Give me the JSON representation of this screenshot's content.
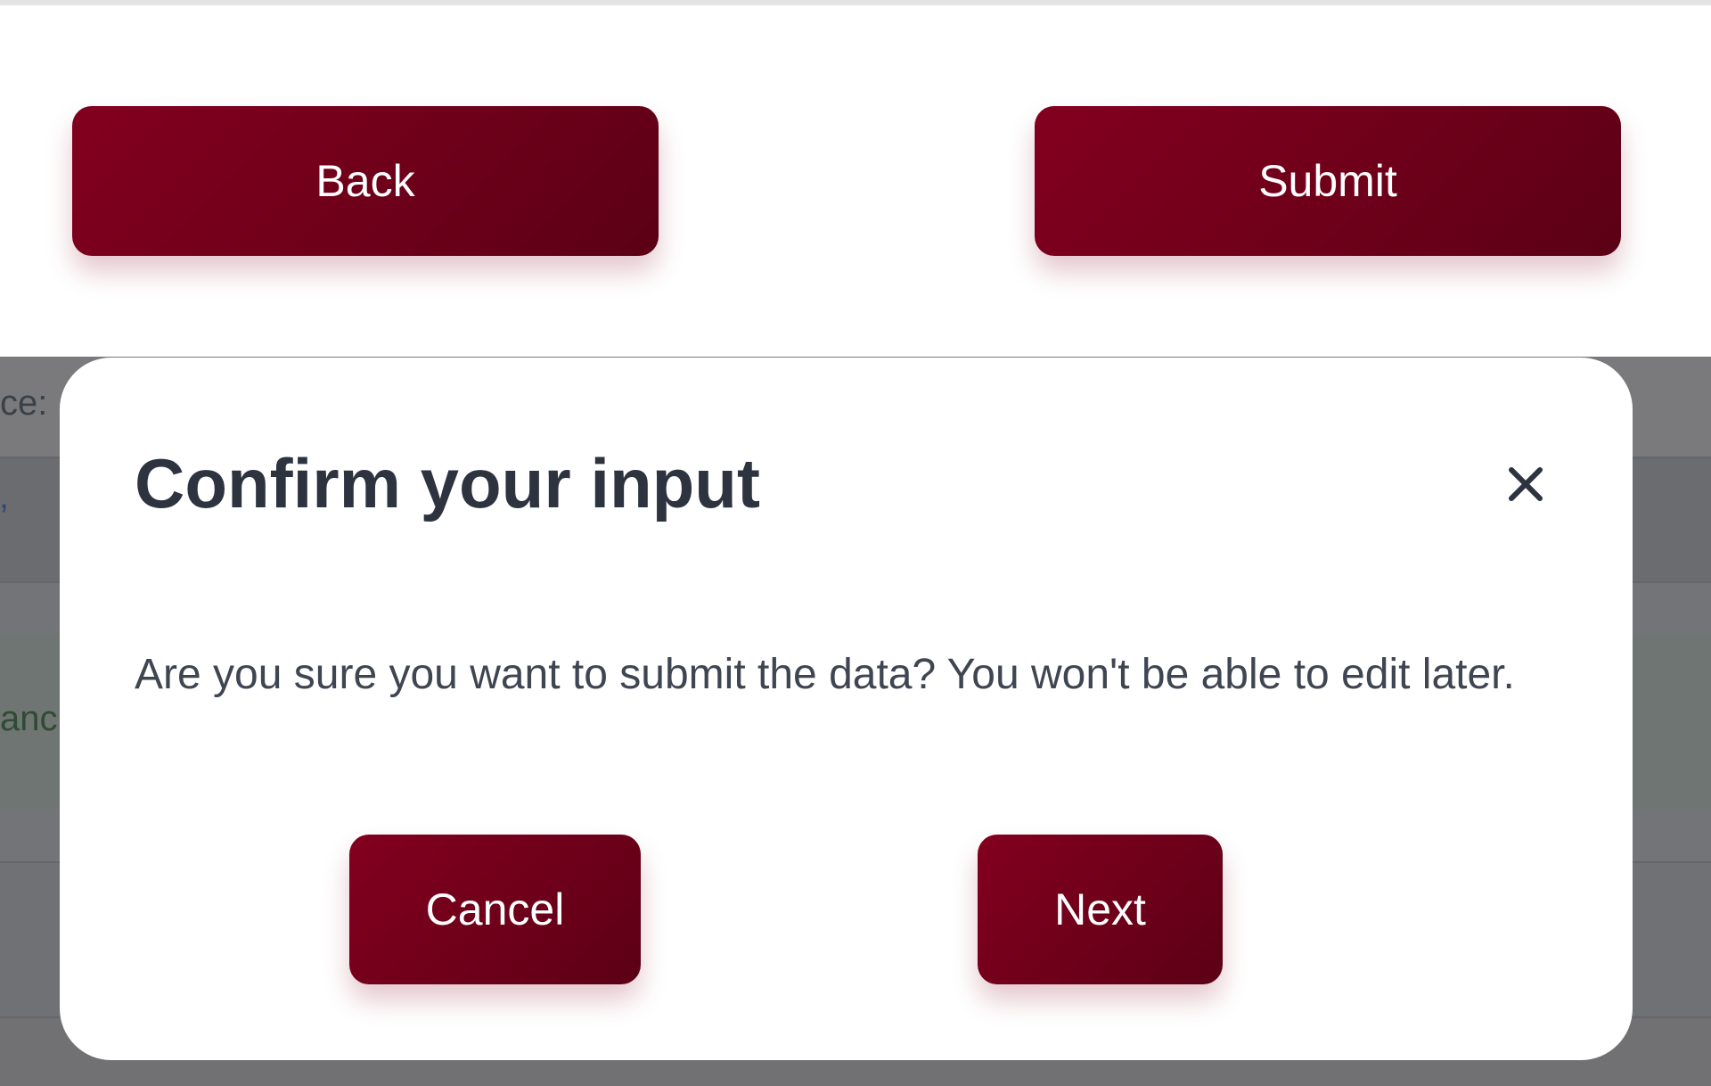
{
  "page": {
    "back_label": "Back",
    "submit_label": "Submit"
  },
  "background_peek": {
    "label_fragment": "ce:",
    "blue_fragment": "’",
    "green_fragment": "anc"
  },
  "modal": {
    "title": "Confirm your input",
    "close_icon": "close-icon",
    "message": "Are you sure you want to submit the data? You won't be able to edit later.",
    "cancel_label": "Cancel",
    "next_label": "Next"
  },
  "colors": {
    "button_primary": "#82001f",
    "button_primary_dark": "#5b0015",
    "title_text": "#2d3440",
    "overlay": "#717173"
  }
}
